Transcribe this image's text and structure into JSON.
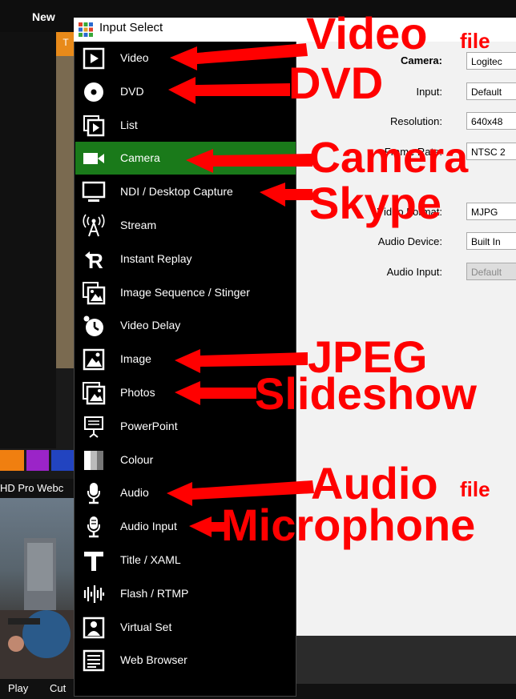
{
  "background": {
    "top_label": "New",
    "tab_label": "T",
    "webcam_label": "HD Pro Webc",
    "bottom_buttons": [
      "Play",
      "Cut"
    ],
    "swatch_colors": [
      "#f07f10",
      "#9b24c8",
      "#2244c0",
      "#ff0000"
    ]
  },
  "window": {
    "title": "Input Select",
    "icon": "grid-icon"
  },
  "menu": [
    {
      "label": "Video",
      "icon": "video-file-icon"
    },
    {
      "label": "DVD",
      "icon": "dvd-icon"
    },
    {
      "label": "List",
      "icon": "list-icon"
    },
    {
      "label": "Camera",
      "icon": "camera-icon",
      "selected": true
    },
    {
      "label": "NDI / Desktop Capture",
      "icon": "monitor-icon"
    },
    {
      "label": "Stream",
      "icon": "antenna-icon"
    },
    {
      "label": "Instant Replay",
      "icon": "replay-icon"
    },
    {
      "label": "Image Sequence / Stinger",
      "icon": "image-sequence-icon"
    },
    {
      "label": "Video Delay",
      "icon": "video-delay-icon"
    },
    {
      "label": "Image",
      "icon": "image-icon"
    },
    {
      "label": "Photos",
      "icon": "photos-icon"
    },
    {
      "label": "PowerPoint",
      "icon": "powerpoint-icon"
    },
    {
      "label": "Colour",
      "icon": "colour-icon"
    },
    {
      "label": "Audio",
      "icon": "microphone-icon"
    },
    {
      "label": "Audio Input",
      "icon": "audio-input-icon"
    },
    {
      "label": "Title / XAML",
      "icon": "title-icon"
    },
    {
      "label": "Flash / RTMP",
      "icon": "flash-icon"
    },
    {
      "label": "Virtual Set",
      "icon": "virtual-set-icon"
    },
    {
      "label": "Web Browser",
      "icon": "web-browser-icon"
    }
  ],
  "settings": {
    "camera_label": "Camera:",
    "camera_value": "Logitec",
    "input_label": "Input:",
    "input_value": "Default",
    "resolution_label": "Resolution:",
    "resolution_value": "640x48",
    "framerate_label": "Frame Rate:",
    "framerate_value": "NTSC 2",
    "video_format_label": "Video Format:",
    "video_format_value": "MJPG",
    "audio_device_label": "Audio Device:",
    "audio_device_value": "Built In",
    "audio_input_label": "Audio Input:",
    "audio_input_value": "Default"
  },
  "annotations": {
    "video": "Video",
    "video_suffix": "file",
    "dvd": "DVD",
    "camera": "Camera",
    "skype": "Skype",
    "jpeg": "JPEG",
    "slideshow": "Slideshow",
    "audio": "Audio",
    "audio_suffix": "file",
    "microphone": "Microphone",
    "color": "#ff0000"
  }
}
